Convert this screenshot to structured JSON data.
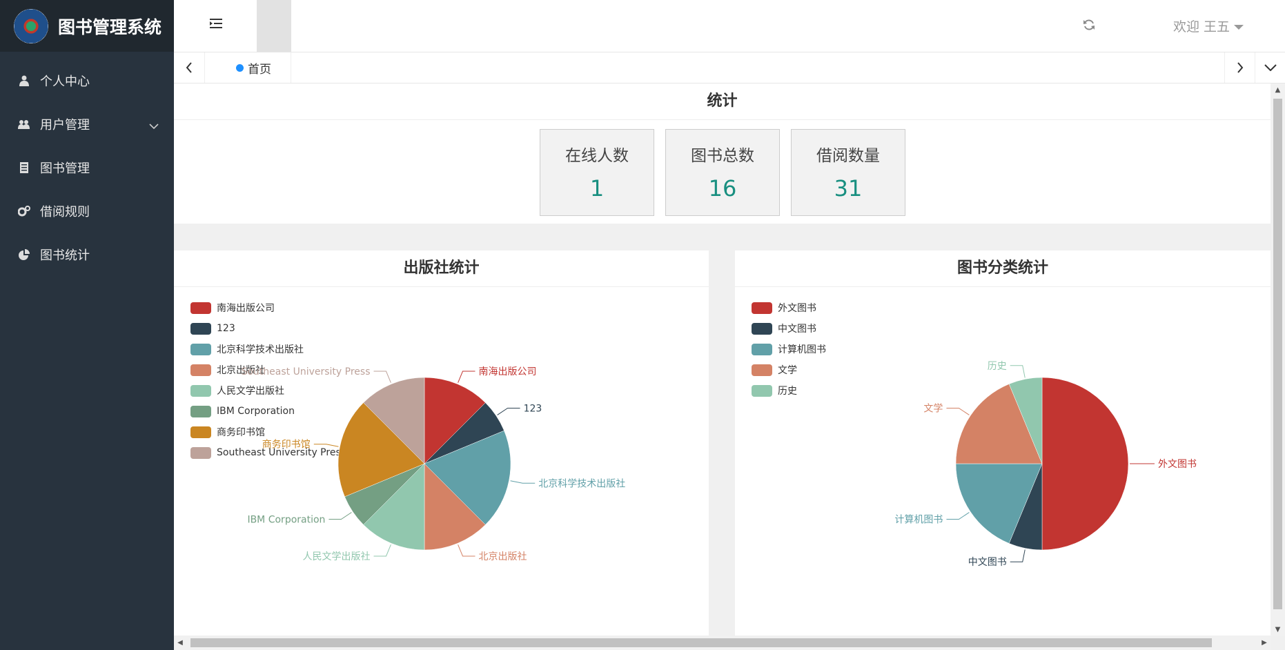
{
  "app": {
    "title": "图书管理系统"
  },
  "sidebar": {
    "items": [
      {
        "label": "个人中心",
        "icon": "user-icon"
      },
      {
        "label": "用户管理",
        "icon": "users-icon",
        "has_children": true
      },
      {
        "label": "图书管理",
        "icon": "book-icon"
      },
      {
        "label": "借阅规则",
        "icon": "gears-icon"
      },
      {
        "label": "图书统计",
        "icon": "pie-chart-icon"
      }
    ]
  },
  "header": {
    "welcome": "欢迎 王五"
  },
  "tabs": {
    "home": "首页"
  },
  "stats": {
    "title": "统计",
    "cards": [
      {
        "label": "在线人数",
        "value": "1"
      },
      {
        "label": "图书总数",
        "value": "16"
      },
      {
        "label": "借阅数量",
        "value": "31"
      }
    ]
  },
  "chart_data": [
    {
      "type": "pie",
      "title": "出版社统计",
      "slices": [
        {
          "name": "南海出版公司",
          "value": 2,
          "color": "#c23531"
        },
        {
          "name": "123",
          "value": 1,
          "color": "#2f4554"
        },
        {
          "name": "北京科学技术出版社",
          "value": 3,
          "color": "#61a0a8"
        },
        {
          "name": "北京出版社",
          "value": 2,
          "color": "#d48265"
        },
        {
          "name": "人民文学出版社",
          "value": 2,
          "color": "#91c7ae"
        },
        {
          "name": "IBM Corporation",
          "value": 1,
          "color": "#749f83"
        },
        {
          "name": "商务印书馆",
          "value": 3,
          "color": "#ca8622"
        },
        {
          "name": "Southeast University Press",
          "value": 2,
          "color": "#bda29a"
        }
      ],
      "legend": "top-left"
    },
    {
      "type": "pie",
      "title": "图书分类统计",
      "slices": [
        {
          "name": "外文图书",
          "value": 8,
          "color": "#c23531"
        },
        {
          "name": "中文图书",
          "value": 1,
          "color": "#2f4554"
        },
        {
          "name": "计算机图书",
          "value": 3,
          "color": "#61a0a8"
        },
        {
          "name": "文学",
          "value": 3,
          "color": "#d48265"
        },
        {
          "name": "历史",
          "value": 1,
          "color": "#91c7ae"
        }
      ],
      "legend": "top-left"
    }
  ]
}
